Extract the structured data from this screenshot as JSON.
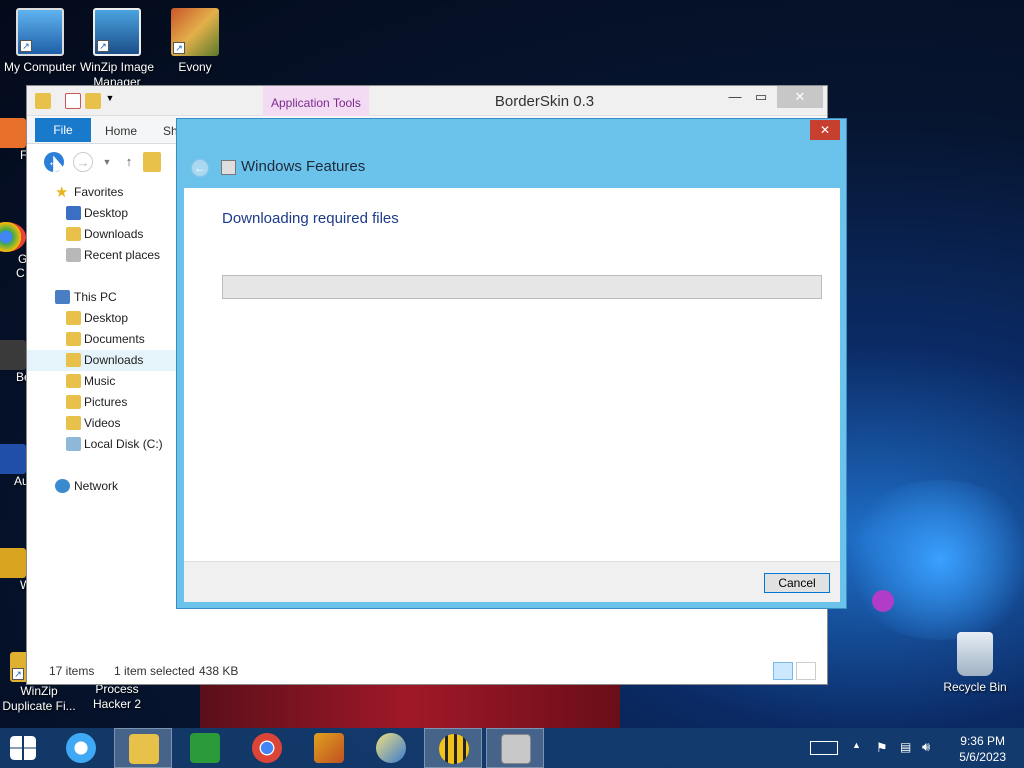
{
  "desktop": {
    "icons": [
      {
        "label": "My Computer"
      },
      {
        "label": "WinZip Image Manager"
      },
      {
        "label": "Evony"
      },
      {
        "label": "WinZip Duplicate Fi..."
      },
      {
        "label": "Process Hacker 2"
      },
      {
        "label": "Recycle Bin"
      }
    ],
    "edge_labels": [
      "F",
      "G",
      "C",
      "Be",
      "Au",
      "W"
    ]
  },
  "explorer": {
    "title": "BorderSkin 0.3",
    "context_tab": "Application Tools",
    "ribbon_tabs": [
      "File",
      "Home",
      "Sh"
    ],
    "nav": {
      "favorites": "Favorites",
      "favorites_items": [
        "Desktop",
        "Downloads",
        "Recent places"
      ],
      "this_pc": "This PC",
      "this_pc_items": [
        "Desktop",
        "Documents",
        "Downloads",
        "Music",
        "Pictures",
        "Videos",
        "Local Disk (C:)"
      ],
      "network": "Network"
    },
    "status": {
      "items": "17 items",
      "selected": "1 item selected",
      "size": "438 KB"
    }
  },
  "dialog": {
    "title": "Windows Features",
    "heading": "Downloading required files",
    "progress": 0,
    "cancel_label": "Cancel",
    "close_glyph": "✕",
    "back_glyph": "←"
  },
  "taskbar": {
    "time": "9:36 PM",
    "date": "5/6/2023"
  },
  "colors": {
    "dialog_frame": "#6bc3ec",
    "file_tab": "#1979ca",
    "context_tab_bg": "#f3dcf3",
    "taskbar": "#143c6e"
  }
}
